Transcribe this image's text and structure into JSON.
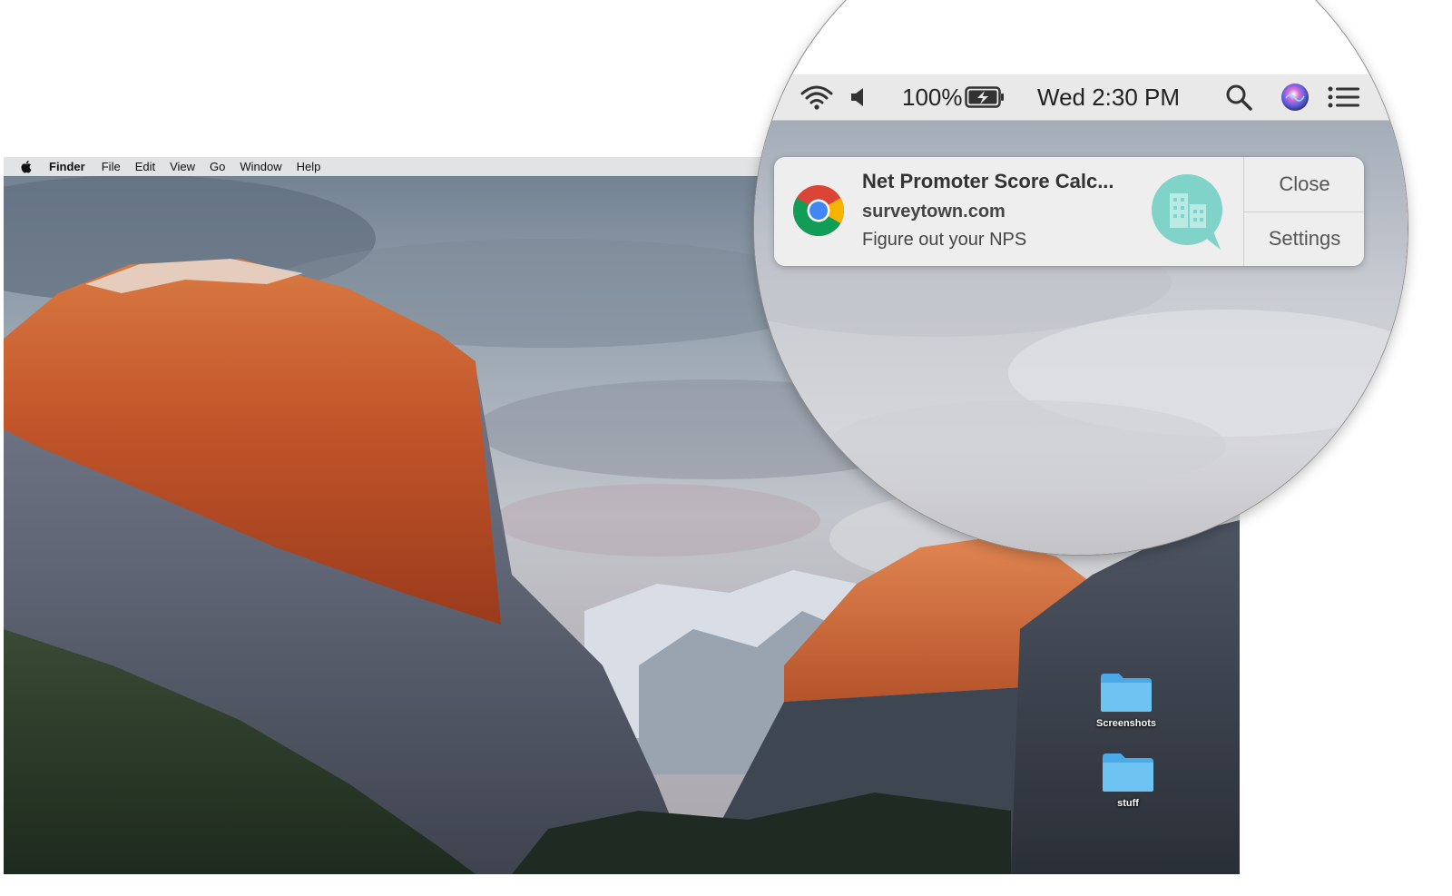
{
  "menubar": {
    "apple_icon": "apple-logo-icon",
    "app_name": "Finder",
    "items": [
      "File",
      "Edit",
      "View",
      "Go",
      "Window",
      "Help"
    ]
  },
  "desktop": {
    "icons": [
      {
        "label": "Screenshots",
        "icon": "folder-icon"
      },
      {
        "label": "stuff",
        "icon": "folder-icon"
      }
    ],
    "folder_color": "#5fb8ee"
  },
  "magnified_menubar": {
    "wifi_icon": "wifi-icon",
    "volume_icon": "volume-icon",
    "battery_percent": "100%",
    "battery_icon": "battery-charging-icon",
    "clock": "Wed 2:30 PM",
    "spotlight_icon": "spotlight-search-icon",
    "siri_icon": "siri-icon",
    "notification_center_icon": "notification-center-icon"
  },
  "notification": {
    "app_icon": "chrome-icon",
    "title": "Net Promoter Score Calc...",
    "subtitle": "surveytown.com",
    "body": "Figure out your NPS",
    "site_icon": "surveytown-building-icon",
    "site_icon_color": "#7fd3c8",
    "actions": {
      "close": "Close",
      "settings": "Settings"
    }
  }
}
